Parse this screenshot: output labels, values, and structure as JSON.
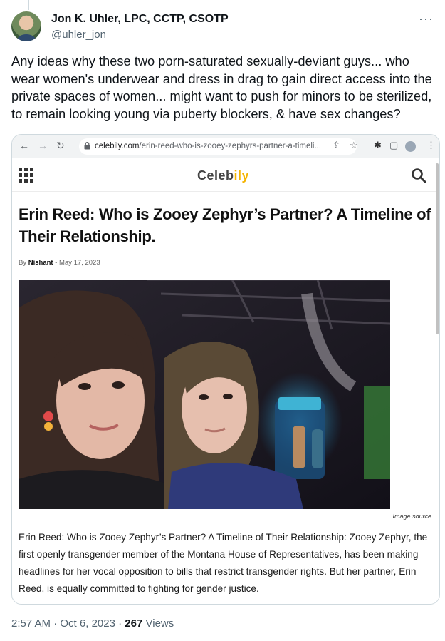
{
  "tweet": {
    "author_name": "Jon K. Uhler, LPC, CCTP, CSOTP",
    "author_handle": "@uhler_jon",
    "more_icon": "more-dots-icon",
    "text": "Any ideas why these two porn-saturated sexually-deviant guys... who wear women's underwear and dress in drag to gain direct access into the private spaces of women... might want to push for minors to be sterilized, to remain looking young via puberty blockers, & have sex changes?",
    "time": "2:57 AM",
    "separator": "·",
    "date": "Oct 6, 2023",
    "views_count": "267",
    "views_label": "Views"
  },
  "screenshot": {
    "browser": {
      "url_domain": "celebily.com",
      "url_path": "/erin-reed-who-is-zooey-zephyrs-partner-a-timeli...",
      "icons": [
        "back-arrow-icon",
        "forward-arrow-icon",
        "reload-icon",
        "lock-icon",
        "share-icon",
        "star-icon",
        "extensions-icon",
        "sidebar-icon",
        "profile-icon",
        "kebab-icon"
      ]
    },
    "site": {
      "logo_main": "Celeb",
      "logo_accent": "ily",
      "accent_color": "#f5b400"
    },
    "article": {
      "title": "Erin Reed: Who is Zooey Zephyr’s Partner? A Timeline of Their Relationship.",
      "by_prefix": "By",
      "author": "Nishant",
      "date_separator": "-",
      "date": "May 17, 2023",
      "image_caption": "Image source",
      "body": "Erin Reed: Who is Zooey Zephyr’s Partner? A Timeline of Their Relationship: Zooey Zephyr, the first openly transgender member of the Montana House of Representatives, has been making headlines for her vocal opposition to bills that restrict transgender rights. But her partner, Erin Reed, is equally committed to fighting for gender justice."
    }
  }
}
